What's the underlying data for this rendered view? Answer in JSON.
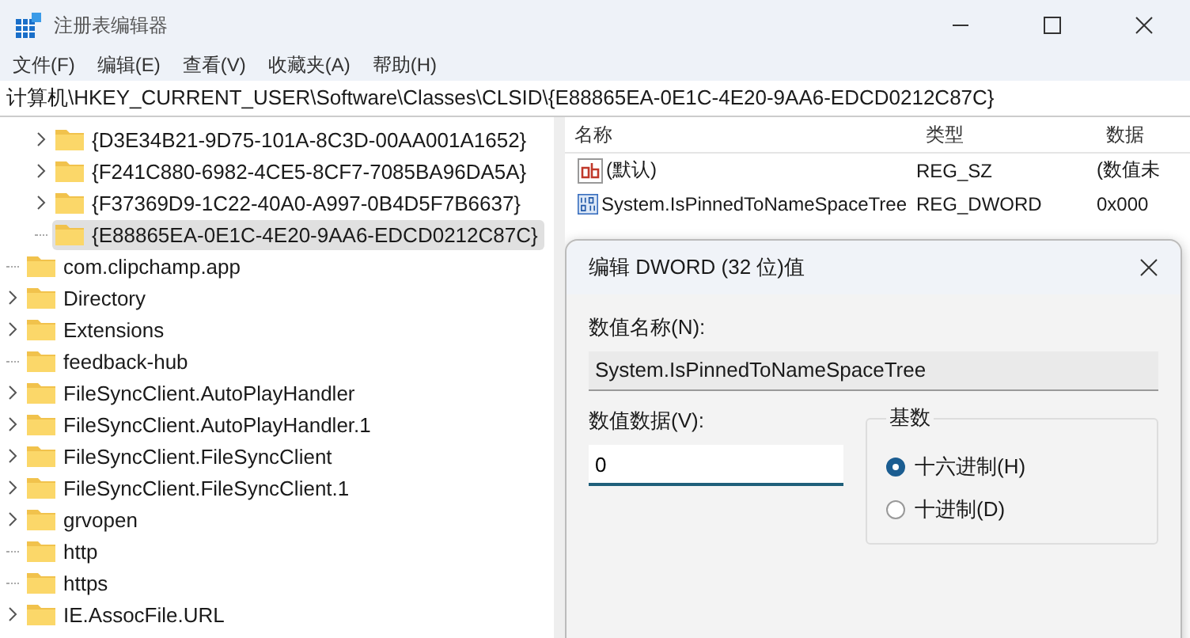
{
  "window": {
    "title": "注册表编辑器"
  },
  "menu": [
    "文件(F)",
    "编辑(E)",
    "查看(V)",
    "收藏夹(A)",
    "帮助(H)"
  ],
  "address": "计算机\\HKEY_CURRENT_USER\\Software\\Classes\\CLSID\\{E88865EA-0E1C-4E20-9AA6-EDCD0212C87C}",
  "tree": {
    "sub_items": [
      {
        "label": "{D3E34B21-9D75-101A-8C3D-00AA001A1652}",
        "expandable": true,
        "selected": false
      },
      {
        "label": "{F241C880-6982-4CE5-8CF7-7085BA96DA5A}",
        "expandable": true,
        "selected": false
      },
      {
        "label": "{F37369D9-1C22-40A0-A997-0B4D5F7B6637}",
        "expandable": true,
        "selected": false
      },
      {
        "label": "{E88865EA-0E1C-4E20-9AA6-EDCD0212C87C}",
        "expandable": false,
        "selected": true
      }
    ],
    "items": [
      {
        "label": "com.clipchamp.app",
        "expandable": false,
        "selected": false
      },
      {
        "label": "Directory",
        "expandable": true,
        "selected": false
      },
      {
        "label": "Extensions",
        "expandable": true,
        "selected": false
      },
      {
        "label": "feedback-hub",
        "expandable": false,
        "selected": false
      },
      {
        "label": "FileSyncClient.AutoPlayHandler",
        "expandable": true,
        "selected": false
      },
      {
        "label": "FileSyncClient.AutoPlayHandler.1",
        "expandable": true,
        "selected": false
      },
      {
        "label": "FileSyncClient.FileSyncClient",
        "expandable": true,
        "selected": false
      },
      {
        "label": "FileSyncClient.FileSyncClient.1",
        "expandable": true,
        "selected": false
      },
      {
        "label": "grvopen",
        "expandable": true,
        "selected": false
      },
      {
        "label": "http",
        "expandable": false,
        "selected": false
      },
      {
        "label": "https",
        "expandable": false,
        "selected": false
      },
      {
        "label": "IE.AssocFile.URL",
        "expandable": true,
        "selected": false
      }
    ]
  },
  "values": {
    "columns": [
      "名称",
      "类型",
      "数据"
    ],
    "rows": [
      {
        "kind": "string",
        "name": "(默认)",
        "type": "REG_SZ",
        "data": "(数值未"
      },
      {
        "kind": "binary",
        "name": "System.IsPinnedToNameSpaceTree",
        "type": "REG_DWORD",
        "data": "0x000"
      }
    ]
  },
  "dialog": {
    "title": "编辑 DWORD (32 位)值",
    "name_label": "数值名称(N):",
    "name_value": "System.IsPinnedToNameSpaceTree",
    "data_label": "数值数据(V):",
    "data_value": "0",
    "base_label": "基数",
    "bases": [
      {
        "label": "十六进制(H)",
        "selected": true
      },
      {
        "label": "十进制(D)",
        "selected": false
      }
    ]
  }
}
